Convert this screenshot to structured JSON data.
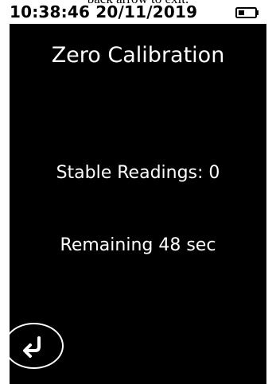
{
  "caption": "back arrow to exit.",
  "status_bar": {
    "time": "10:38:46",
    "date": "20/11/2019",
    "battery_icon": "battery-icon"
  },
  "screen": {
    "title": "Zero Calibration",
    "stable_readings": "Stable Readings: 0",
    "remaining": "Remaining 48 sec"
  },
  "controls": {
    "back_icon": "return-arrow-icon"
  },
  "colors": {
    "screen_background": "#000000",
    "text": "#ffffff",
    "status_bar_background": "#ffffff"
  }
}
